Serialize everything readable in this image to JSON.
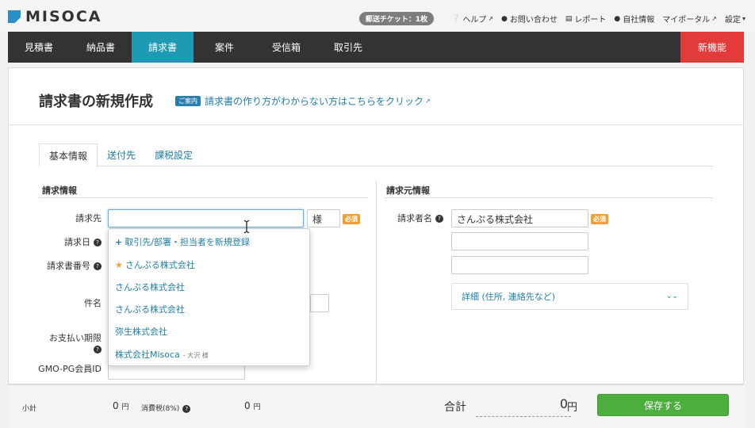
{
  "app": {
    "logo_text": "MISOCA"
  },
  "topnav": {
    "ticket": "郵送チケット：1枚",
    "items": [
      {
        "icon": "question-circle-icon",
        "label": "ヘルプ"
      },
      {
        "icon": "chat-bubble-icon",
        "label": "お問い合わせ"
      },
      {
        "icon": "bar-chart-icon",
        "label": "レポート"
      },
      {
        "icon": "person-icon",
        "label": "自社情報"
      },
      {
        "icon": "",
        "label": "マイポータル"
      },
      {
        "icon": "",
        "label": "設定"
      }
    ]
  },
  "mainnav": {
    "items": [
      "見積書",
      "納品書",
      "請求書",
      "案件",
      "受信箱",
      "取引先"
    ],
    "active": 2,
    "new_feature": "新機能"
  },
  "page": {
    "title": "請求書の新規作成",
    "guide_badge": "ご案内",
    "guide_link": "請求書の作り方がわからない方はこちらをクリック"
  },
  "tabs": [
    "基本情報",
    "送付先",
    "課税設定"
  ],
  "invoice_info": {
    "title": "請求情報",
    "client_label": "請求先",
    "client_value": "",
    "honorific": "様",
    "required": "必須",
    "date_label": "請求日",
    "number_label": "請求書番号",
    "subject_label": "件名",
    "due_label": "お支払い期限",
    "gmo_label": "GMO-PG会員ID"
  },
  "dropdown": {
    "new_entry": "取引先/部署・担当者を新規登録",
    "items": [
      {
        "name": "さんぷる株式会社",
        "starred": true,
        "sub": ""
      },
      {
        "name": "さんぷる株式会社",
        "starred": false,
        "sub": ""
      },
      {
        "name": "さんぷる株式会社",
        "starred": false,
        "sub": ""
      },
      {
        "name": "弥生株式会社",
        "starred": false,
        "sub": ""
      },
      {
        "name": "株式会社Misoca",
        "starred": false,
        "sub": "- 大沢 様"
      }
    ]
  },
  "issuer_info": {
    "title": "請求元情報",
    "name_label": "請求者名",
    "name_value": "さんぷる株式会社",
    "required": "必須",
    "details": "詳細 (住所, 連絡先など)"
  },
  "totals": {
    "subtotal_label": "小計",
    "subtotal_value": "0",
    "tax_label": "消費税(8%)",
    "tax_value": "0",
    "unit": "円",
    "total_label": "合計",
    "total_value": "0",
    "save": "保存する"
  },
  "colors": {
    "accent": "#1f9ab5",
    "new_feature": "#e33a3a",
    "save": "#4caf3d",
    "required": "#f0a030"
  }
}
